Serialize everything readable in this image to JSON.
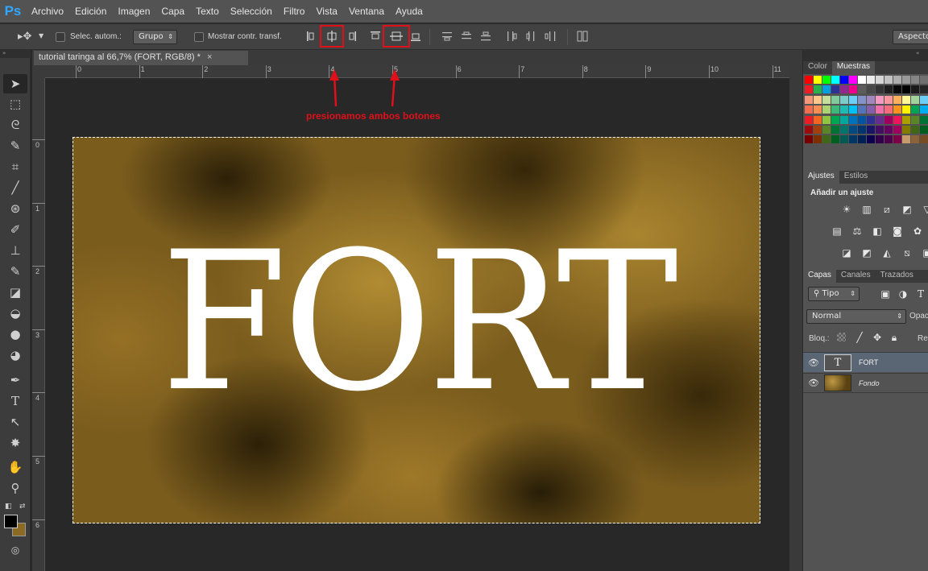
{
  "app": {
    "logo": "Ps"
  },
  "menu": [
    "Archivo",
    "Edición",
    "Imagen",
    "Capa",
    "Texto",
    "Selección",
    "Filtro",
    "Vista",
    "Ventana",
    "Ayuda"
  ],
  "options": {
    "auto_select_label": "Selec. autom.:",
    "group_value": "Grupo",
    "transform_label": "Mostrar contr. transf.",
    "workspace_label": "Aspectos"
  },
  "document": {
    "tab_title": "tutorial taringa al 66,7% (FORT, RGB/8) *",
    "close_glyph": "×",
    "canvas_text": "FORT"
  },
  "annotation": {
    "text": "presionamos ambos botones",
    "color": "#e0101a"
  },
  "rulers": {
    "top": [
      "0",
      "1",
      "2",
      "3",
      "4",
      "5",
      "6",
      "7",
      "8",
      "9",
      "10",
      "11"
    ],
    "left": [
      "0",
      "1",
      "2",
      "3",
      "4",
      "5",
      "6"
    ]
  },
  "panels": {
    "swatches": {
      "tabs": [
        "Color",
        "Muestras"
      ],
      "active": "Muestras"
    },
    "adjustments": {
      "tabs": [
        "Ajustes",
        "Estilos"
      ],
      "active": "Ajustes",
      "heading": "Añadir un ajuste"
    },
    "layers": {
      "tabs": [
        "Capas",
        "Canales",
        "Trazados"
      ],
      "active": "Capas",
      "filter_label": "Tipo",
      "blend_mode": "Normal",
      "opacity_label": "Opac",
      "lock_label": "Bloq.:",
      "fill_label": "Re",
      "items": [
        {
          "name": "FORT",
          "kind": "text",
          "thumb_glyph": "T",
          "selected": true
        },
        {
          "name": "Fondo",
          "kind": "image",
          "selected": false
        }
      ]
    }
  },
  "icons": [
    "move-tool-icon",
    "marquee-tool-icon",
    "lasso-tool-icon",
    "quick-select-tool-icon",
    "crop-tool-icon",
    "eyedropper-tool-icon",
    "healing-brush-icon",
    "brush-tool-icon",
    "clone-stamp-icon",
    "history-brush-icon",
    "eraser-icon",
    "paint-bucket-icon",
    "blur-tool-icon",
    "dodge-tool-icon",
    "pen-tool-icon",
    "type-tool-icon",
    "path-select-icon",
    "shape-tool-icon",
    "hand-tool-icon",
    "zoom-tool-icon",
    "eye-icon",
    "lock-icon"
  ],
  "colors": {
    "foreground": "#000000",
    "background": "#8b6a24"
  }
}
